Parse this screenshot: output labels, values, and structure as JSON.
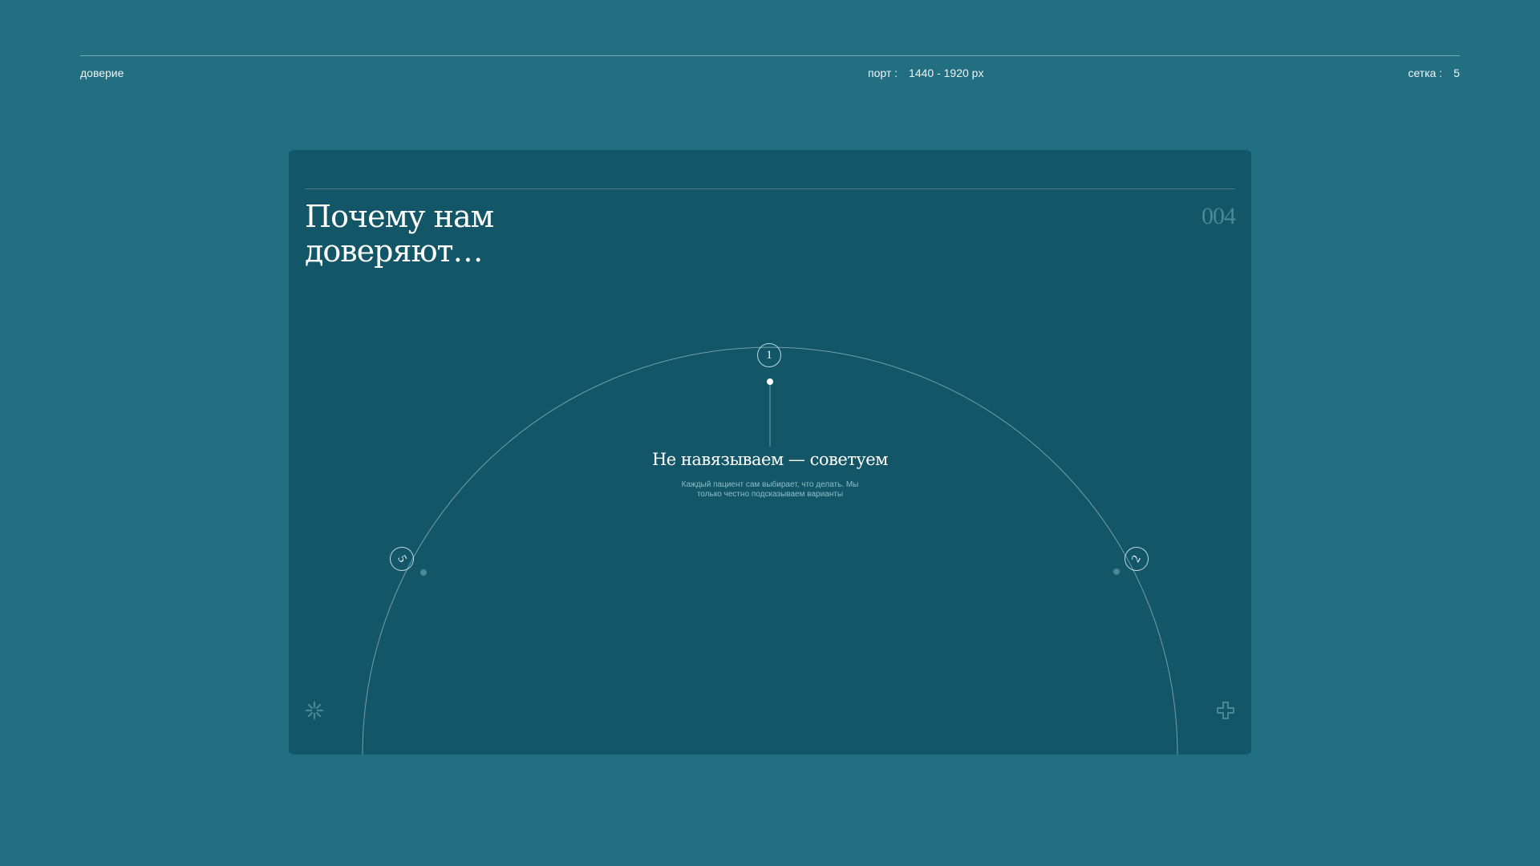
{
  "header": {
    "section_label": "доверие",
    "port_label": "порт :",
    "port_value": "1440 - 1920 px",
    "grid_label": "сетка :",
    "grid_value": "5"
  },
  "card": {
    "title": "Почему нам доверяют…",
    "number": "004",
    "steps": [
      {
        "badge": "1",
        "state": "active"
      },
      {
        "badge": "2",
        "state": "inactive"
      },
      {
        "badge": "5",
        "state": "inactive"
      }
    ],
    "active_step": {
      "heading": "Не навязываем — советуем",
      "description": "Каждый пациент сам выбирает, что делать. Мы только честно подсказываем варианты"
    },
    "icons": {
      "bottom_left": "sparkle-icon",
      "bottom_right": "medical-cross-icon"
    }
  },
  "colors": {
    "page_background": "#236f82",
    "card_background": "#135668",
    "accent_muted": "#4d8795"
  }
}
